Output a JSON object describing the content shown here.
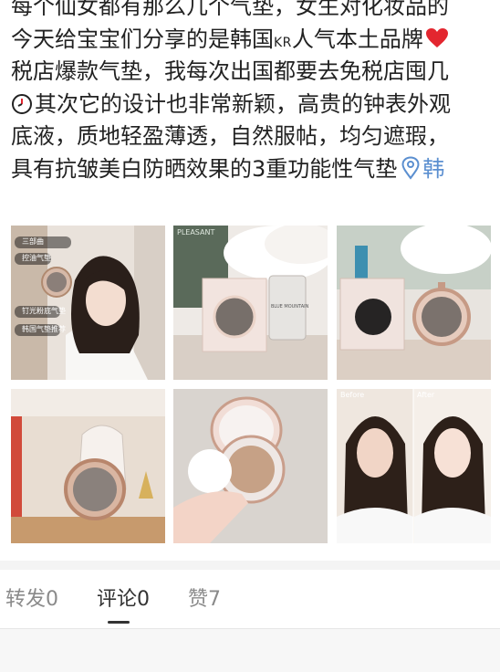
{
  "post": {
    "line1": "每个仙女都有那么几个气垫，女生对化妆品的",
    "line2_a": "今天给宝宝们分享的是韩国",
    "line2_kr": "KR",
    "line2_b": "人气本土品牌",
    "line3": "税店爆款气垫，我每次出国都要去免税店囤几",
    "line4": "其次它的设计也非常新颖，高贵的钟表外观",
    "line5": "底液，质地轻盈薄透，自然服帖，均匀遮瑕，",
    "line6": "具有抗皱美白防晒效果的3重功能性气垫",
    "location_label": "韩",
    "heart_icon": "red-heart-emoji",
    "clock_icon": "clock-emoji",
    "location_icon": "location-pin-icon"
  },
  "photos": {
    "p1_tag1": "三部曲",
    "p1_tag2": "控油气垫",
    "p1_tag3": "钉光粉底气垫",
    "p1_tag4": "韩国气垫推荐",
    "p2_box_text": "BLUE MOUNTAIN",
    "p2_shelf_text": "PLEASANT",
    "p6_before": "Before",
    "p6_after": "After"
  },
  "tabs": {
    "repost": "转发0",
    "comment": "评论0",
    "like": "赞7"
  },
  "colors": {
    "text": "#222222",
    "link": "#5b8fd0",
    "heart": "#e3262f",
    "tab_inactive": "#8a8a8a",
    "tab_active": "#333333"
  }
}
